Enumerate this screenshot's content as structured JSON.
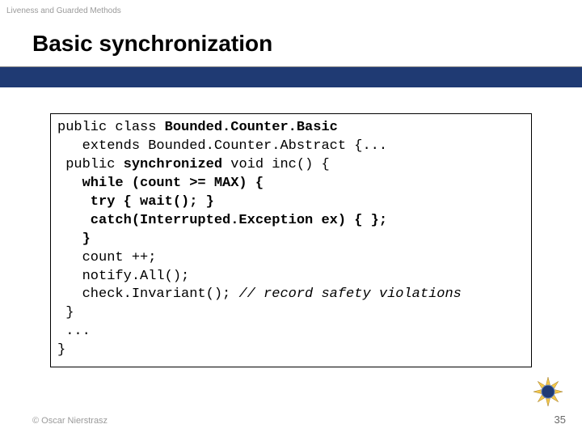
{
  "breadcrumb": "Liveness and Guarded Methods",
  "title": "Basic synchronization",
  "code": {
    "l1a": "public class ",
    "l1b": "Bounded.Counter.Basic",
    "l2": "   extends Bounded.Counter.Abstract {...",
    "l3a": " public ",
    "l3b": "synchronized",
    "l3c": " void inc() {",
    "l4": "   while (count >= MAX) {",
    "l5": "    try { wait(); }",
    "l6": "    catch(Interrupted.Exception ex) { };",
    "l7": "   }",
    "l8": "   count ++;",
    "l9": "   notify.All();",
    "l10a": "   check.Invariant(); ",
    "l10b": "// record safety violations",
    "l11": " }",
    "l12": " ...",
    "l13": "}"
  },
  "footer": "© Oscar Nierstrasz",
  "pagenum": "35"
}
